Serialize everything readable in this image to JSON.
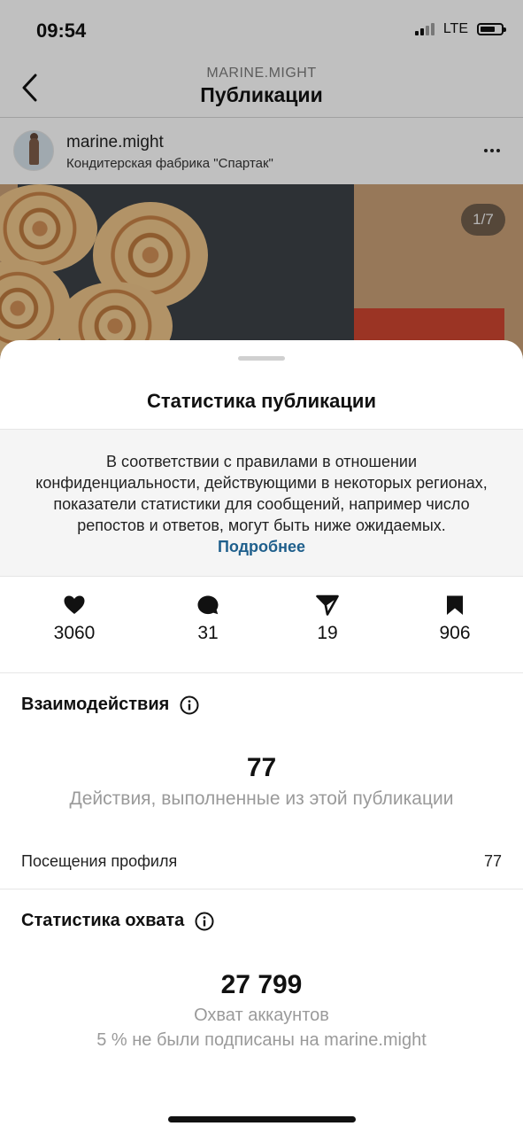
{
  "status_bar": {
    "time": "09:54",
    "network": "LTE"
  },
  "header": {
    "subtitle": "MARINE.MIGHT",
    "title": "Публикации"
  },
  "post": {
    "username": "marine.might",
    "location": "Кондитерская фабрика \"Спартак\"",
    "image_counter": "1/7"
  },
  "sheet": {
    "title": "Статистика публикации",
    "notice_text": "В соответствии с правилами в отношении конфиденциальности, действующими в некоторых регионах, показатели статистики для сообщений, например число репостов и ответов, могут быть ниже ожидаемых.",
    "notice_link": "Подробнее",
    "metrics": [
      {
        "icon": "heart-icon",
        "value": "3060"
      },
      {
        "icon": "comment-icon",
        "value": "31"
      },
      {
        "icon": "send-icon",
        "value": "19"
      },
      {
        "icon": "bookmark-icon",
        "value": "906"
      }
    ],
    "interactions": {
      "title": "Взаимодействия",
      "value": "77",
      "caption": "Действия, выполненные из этой публикации",
      "rows": [
        {
          "label": "Посещения профиля",
          "value": "77"
        }
      ]
    },
    "reach": {
      "title": "Статистика охвата",
      "value": "27 799",
      "caption": "Охват аккаунтов",
      "subcaption": "5 % не были подписаны на marine.might"
    }
  },
  "colors": {
    "link": "#1f5f8c",
    "muted_text": "#9a9a9a",
    "sheet_bg": "#ffffff"
  }
}
